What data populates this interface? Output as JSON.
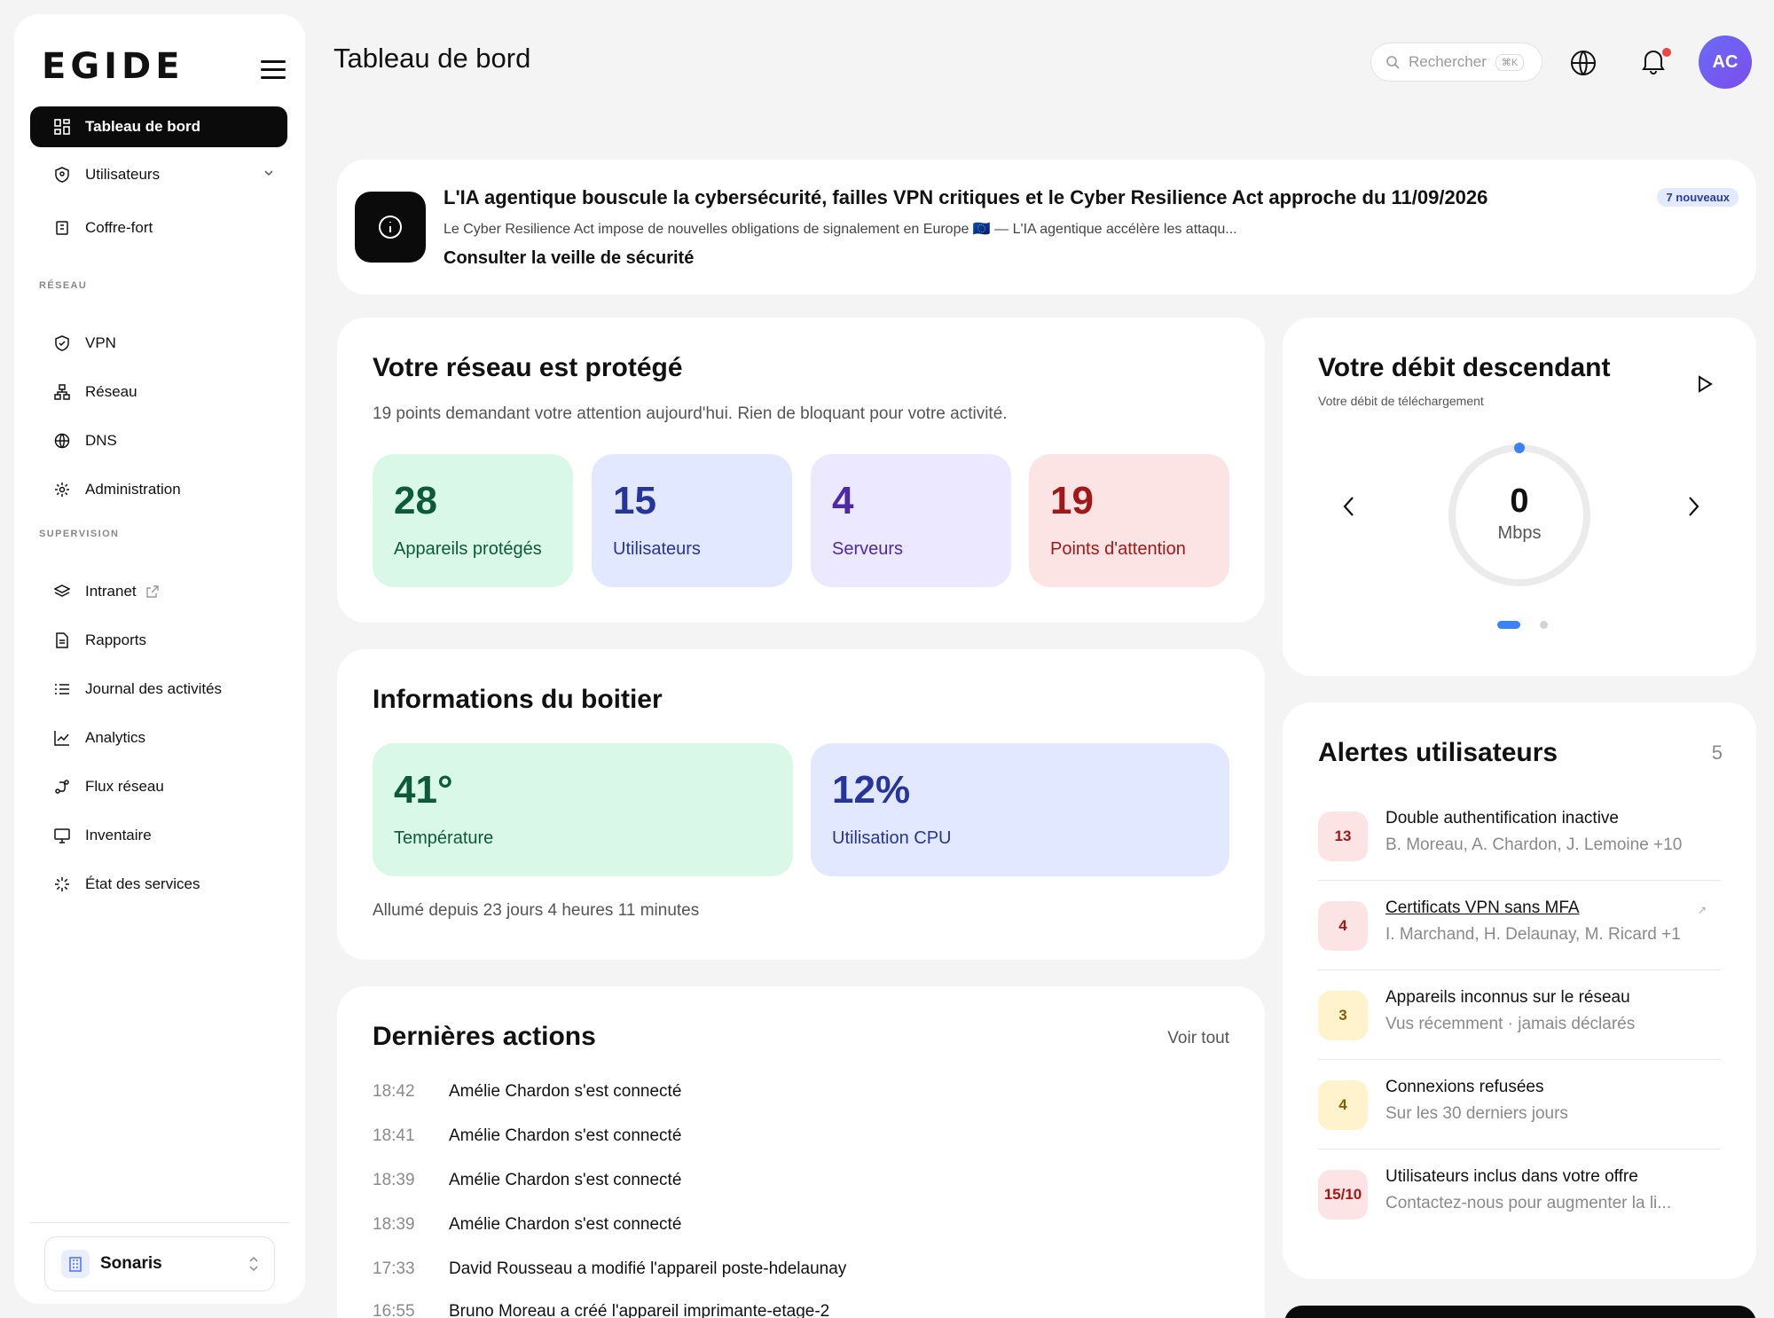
{
  "app": {
    "logo": "EGIDE"
  },
  "sidebar": {
    "items": [
      {
        "label": "Tableau de bord"
      },
      {
        "label": "Utilisateurs"
      },
      {
        "label": "Coffre-fort"
      }
    ],
    "section_reseau": "RÉSEAU",
    "reseau_items": [
      {
        "label": "VPN"
      },
      {
        "label": "Réseau"
      },
      {
        "label": "DNS"
      },
      {
        "label": "Administration"
      }
    ],
    "section_supervision": "SUPERVISION",
    "supervision_items": [
      {
        "label": "Intranet"
      },
      {
        "label": "Rapports"
      },
      {
        "label": "Journal des activités"
      },
      {
        "label": "Analytics"
      },
      {
        "label": "Flux réseau"
      },
      {
        "label": "Inventaire"
      },
      {
        "label": "État des services"
      }
    ],
    "org": "Sonaris"
  },
  "header": {
    "title": "Tableau de bord",
    "search_placeholder": "Rechercher",
    "search_shortcut": "⌘K",
    "avatar_initials": "AC"
  },
  "news": {
    "title": "L'IA agentique bouscule la cybersécurité, failles VPN critiques et le Cyber Resilience Act approche du 11/09/2026",
    "subtitle": "Le Cyber Resilience Act impose de nouvelles obligations de signalement en Europe 🇪🇺 — L'IA agentique accélère les attaqu...",
    "link": "Consulter la veille de sécurité",
    "badge": "7 nouveaux"
  },
  "network": {
    "title": "Votre réseau est protégé",
    "subtitle": "19 points demandant votre attention aujourd'hui. Rien de bloquant pour votre activité.",
    "stats": [
      {
        "value": "28",
        "label": "Appareils protégés",
        "bg": "#d9f8e8",
        "fg": "#0d5a3a"
      },
      {
        "value": "15",
        "label": "Utilisateurs",
        "bg": "#e2e8ff",
        "fg": "#26359a"
      },
      {
        "value": "4",
        "label": "Serveurs",
        "bg": "#ece8ff",
        "fg": "#4c2aa6"
      },
      {
        "value": "19",
        "label": "Points d'attention",
        "bg": "#fde4e4",
        "fg": "#a01818"
      }
    ]
  },
  "box": {
    "title": "Informations du boitier",
    "stats": [
      {
        "value": "41°",
        "label": "Température",
        "bg": "#d9f8e8",
        "fg": "#0d5a3a"
      },
      {
        "value": "12%",
        "label": "Utilisation CPU",
        "bg": "#e2e8ff",
        "fg": "#26359a"
      }
    ],
    "uptime": "Allumé depuis 23 jours 4 heures 11 minutes"
  },
  "actions": {
    "title": "Dernières actions",
    "see_all": "Voir tout",
    "rows": [
      {
        "time": "18:42",
        "text": "Amélie Chardon s'est connecté"
      },
      {
        "time": "18:41",
        "text": "Amélie Chardon s'est connecté"
      },
      {
        "time": "18:39",
        "text": "Amélie Chardon s'est connecté"
      },
      {
        "time": "18:39",
        "text": "Amélie Chardon s'est connecté"
      },
      {
        "time": "17:33",
        "text": "David Rousseau a modifié l'appareil poste-hdelaunay"
      },
      {
        "time": "16:55",
        "text": "Bruno Moreau a créé l'appareil imprimante-etage-2"
      }
    ]
  },
  "debit": {
    "title": "Votre débit descendant",
    "subtitle": "Votre débit de téléchargement",
    "value": "0",
    "unit": "Mbps"
  },
  "alerts": {
    "title": "Alertes utilisateurs",
    "count": "5",
    "items": [
      {
        "badge": "13",
        "title": "Double authentification inactive",
        "sub": "B. Moreau, A. Chardon, J. Lemoine +10",
        "bg": "#fde4e4",
        "fg": "#a01818",
        "link": false
      },
      {
        "badge": "4",
        "title": "Certificats VPN sans MFA",
        "sub": "I. Marchand, H. Delaunay, M. Ricard +1",
        "bg": "#fde4e4",
        "fg": "#a01818",
        "link": true
      },
      {
        "badge": "3",
        "title": "Appareils inconnus sur le réseau",
        "sub": "Vus récemment · jamais déclarés",
        "bg": "#fef3cd",
        "fg": "#8a5a00",
        "link": false
      },
      {
        "badge": "4",
        "title": "Connexions refusées",
        "sub": "Sur les 30 derniers jours",
        "bg": "#fef3cd",
        "fg": "#8a5a00",
        "link": false
      },
      {
        "badge": "15/10",
        "title": "Utilisateurs inclus dans votre offre",
        "sub": "Contactez-nous pour augmenter la li...",
        "bg": "#fde4e4",
        "fg": "#a01818",
        "link": false
      }
    ]
  }
}
